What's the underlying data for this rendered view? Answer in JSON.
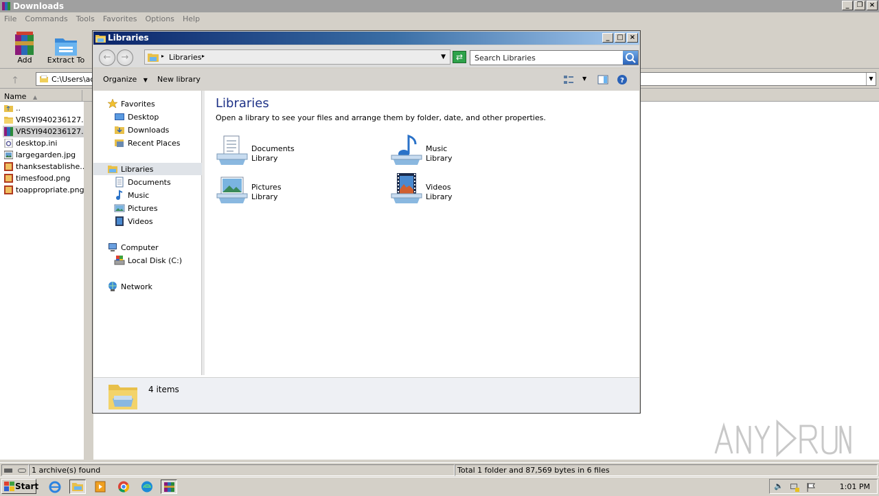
{
  "rar": {
    "title": "Downloads",
    "menu": [
      "File",
      "Commands",
      "Tools",
      "Favorites",
      "Options",
      "Help"
    ],
    "toolbar": {
      "add_label": "Add",
      "extract_label": "Extract To"
    },
    "address": "C:\\Users\\ac",
    "column_name": "Name",
    "files": [
      "..",
      "VRSYI940236127...",
      "VRSYI940236127...",
      "desktop.ini",
      "largegarden.jpg",
      "thanksestablishe...",
      "timesfood.png",
      "toappropriate.png"
    ],
    "status_left": "1 archive(s) found",
    "status_right": "Total 1 folder and 87,569 bytes in 6 files"
  },
  "explorer": {
    "title": "Libraries",
    "breadcrumb": "Libraries",
    "search_placeholder": "Search Libraries",
    "organize_label": "Organize",
    "new_library_label": "New library",
    "nav": {
      "favorites": "Favorites",
      "desktop": "Desktop",
      "downloads": "Downloads",
      "recent_places": "Recent Places",
      "libraries": "Libraries",
      "documents": "Documents",
      "music": "Music",
      "pictures": "Pictures",
      "videos": "Videos",
      "computer": "Computer",
      "local_disk": "Local Disk (C:)",
      "network": "Network"
    },
    "heading": "Libraries",
    "description": "Open a library to see your files and arrange them by folder, date, and other properties.",
    "libraries": [
      {
        "name": "Documents",
        "type": "Library",
        "icon": "documents-library-icon"
      },
      {
        "name": "Music",
        "type": "Library",
        "icon": "music-library-icon"
      },
      {
        "name": "Pictures",
        "type": "Library",
        "icon": "pictures-library-icon"
      },
      {
        "name": "Videos",
        "type": "Library",
        "icon": "videos-library-icon"
      }
    ],
    "item_count": "4 items"
  },
  "taskbar": {
    "start_label": "Start",
    "clock": "1:01 PM"
  },
  "colors": {
    "titlebar_active": "#0a246a",
    "heading_blue": "#1e3287",
    "selection": "#dfe3e8"
  }
}
